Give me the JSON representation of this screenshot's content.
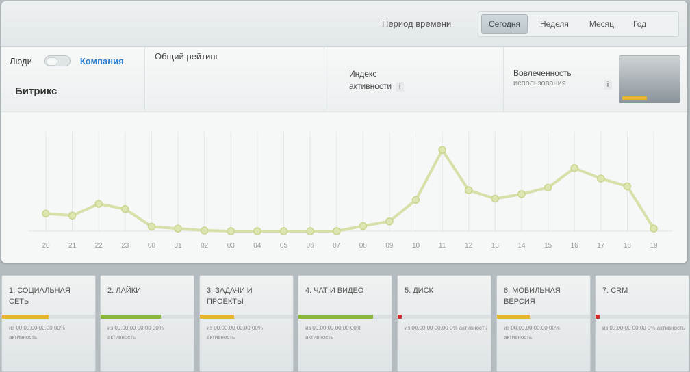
{
  "topbar": {
    "period_label": "Период времени",
    "periods": [
      "Сегодня",
      "Неделя",
      "Месяц",
      "Год"
    ],
    "active_period": 0
  },
  "header": {
    "toggle_left": "Люди",
    "toggle_right": "Компания",
    "company_name": "Битрикс",
    "rating_label": "Общий рейтинг",
    "activity_label": "Индекс активности",
    "engagement_label": "Вовлеченность",
    "engagement_sub": "использования",
    "info_mark": "i",
    "thumb_progress": 0.4
  },
  "chart_data": {
    "type": "line",
    "x": [
      "20",
      "21",
      "22",
      "23",
      "00",
      "01",
      "02",
      "03",
      "04",
      "05",
      "06",
      "07",
      "08",
      "09",
      "10",
      "11",
      "12",
      "13",
      "14",
      "15",
      "16",
      "17",
      "18",
      "19"
    ],
    "values": [
      27,
      24,
      42,
      34,
      7,
      4,
      1,
      0,
      0,
      0,
      0,
      0,
      8,
      15,
      48,
      125,
      63,
      50,
      57,
      67,
      97,
      81,
      69,
      4
    ],
    "ylim": [
      0,
      140
    ],
    "grid": "vertical",
    "color": "#d6e0a8"
  },
  "cards": [
    {
      "title": "1. Социальная сеть",
      "progress": 0.5,
      "bar_color": "#e6b52b",
      "sub": "из 00.00.00 00.00 00% активность"
    },
    {
      "title": "2. Лайки",
      "progress": 0.65,
      "bar_color": "#8ab83c",
      "sub": "из 00.00.00 00.00 00% активность"
    },
    {
      "title": "3. Задачи и проекты",
      "progress": 0.37,
      "bar_color": "#e6b52b",
      "sub": "из 00.00.00 00.00 00% активность"
    },
    {
      "title": "4. Чат и видео",
      "progress": 0.8,
      "bar_color": "#8ab83c",
      "sub": "из 00.00.00 00.00 00% активность"
    },
    {
      "title": "5. Диск",
      "progress": 0,
      "bar_color": "#c9302c",
      "sub": "из 00.00.00 00.00 0% активность"
    },
    {
      "title": "6. Мобильная версия",
      "progress": 0.35,
      "bar_color": "#e6b52b",
      "sub": "из 00.00.00 00.00 00% активность"
    },
    {
      "title": "7. CRM",
      "progress": 0,
      "bar_color": "#c9302c",
      "sub": "из 00.00.00 00.00 0% активность"
    }
  ]
}
